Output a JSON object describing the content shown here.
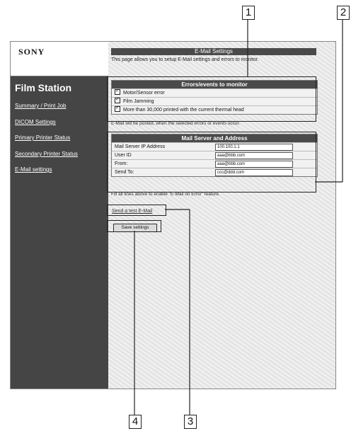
{
  "sidebar": {
    "logo": "SONY",
    "title": "Film Station",
    "items": [
      {
        "label": "Summary / Print Job"
      },
      {
        "label": "DICOM Settings"
      },
      {
        "label": "Primary Printer Status"
      },
      {
        "label": "Secondary Printer Status"
      },
      {
        "label": "E-Mail settings"
      }
    ]
  },
  "main": {
    "header": "E-Mail Settings",
    "description": "This page allows you to setup E-Mail settings and errors to monitor.",
    "errors": {
      "title": "Errors/events to monitor",
      "items": [
        {
          "label": "Motor/Sensor error",
          "checked": true
        },
        {
          "label": "Film Jamming",
          "checked": true
        },
        {
          "label": "More than 30,000 printed with the current thermal head",
          "checked": true
        }
      ],
      "note": "E-Mail will be posted, when the selected errors or events occur."
    },
    "mail": {
      "title": "Mail Server and Address",
      "fields": [
        {
          "label": "Mail Server IP Address",
          "value": "100.100.1.1"
        },
        {
          "label": "User ID",
          "value": "aaa@bbb.com"
        },
        {
          "label": "From:",
          "value": "aaa@bbb.com"
        },
        {
          "label": "Send To:",
          "value": "ccc@ddd.com"
        }
      ],
      "note": "Fill all lines above to enable \"E-Mail on Error\" feature."
    },
    "test_link": "Send a test E-Mail",
    "save_label": "Save settings"
  },
  "callouts": [
    "1",
    "2",
    "3",
    "4"
  ]
}
